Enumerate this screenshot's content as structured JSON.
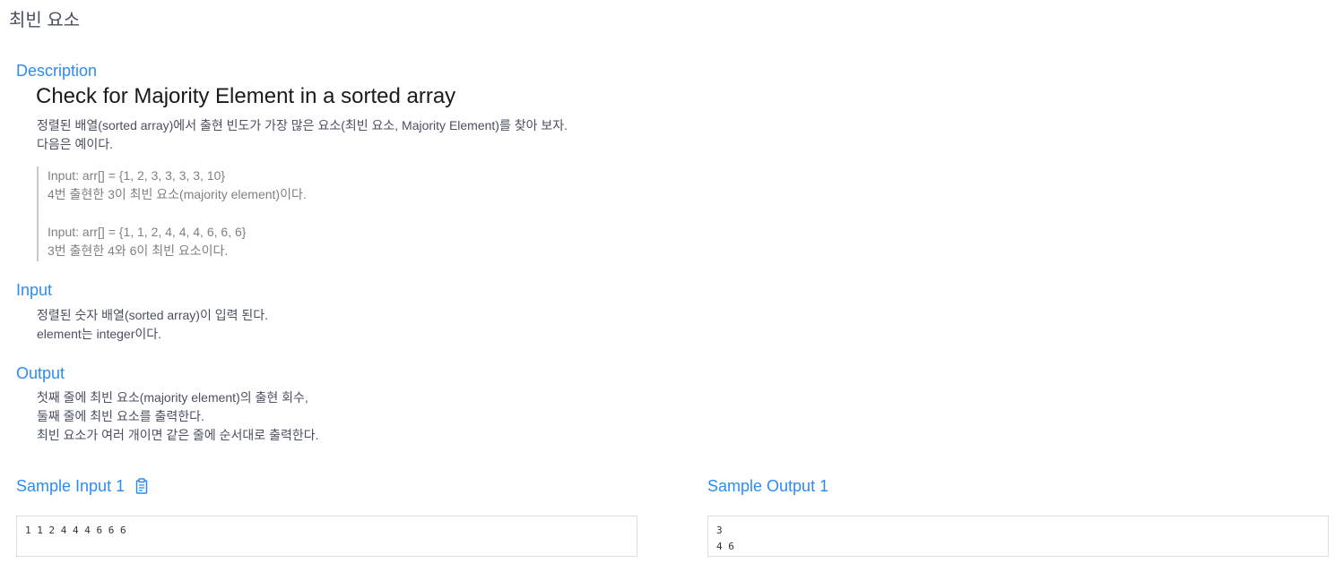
{
  "page_title": "최빈 요소",
  "description": {
    "heading": "Description",
    "problem_title": "Check for Majority Element in a sorted array",
    "lines": [
      "정렬된 배열(sorted array)에서 출현 빈도가 가장 많은 요소(최빈 요소, Majority Element)를 찾아 보자.",
      "다음은 예이다."
    ],
    "examples": [
      {
        "input": "Input: arr[] = {1, 2, 3, 3, 3, 3, 10}",
        "explain": "4번 출현한 3이 최빈 요소(majority element)이다."
      },
      {
        "input": "Input: arr[] = {1, 1, 2, 4, 4, 4, 6, 6, 6}",
        "explain": "3번 출현한 4와 6이 최빈 요소이다."
      }
    ]
  },
  "input": {
    "heading": "Input",
    "lines": [
      "정렬된 숫자 배열(sorted array)이 입력 된다.",
      "element는 integer이다."
    ]
  },
  "output": {
    "heading": "Output",
    "lines": [
      "첫째 줄에 최빈 요소(majority element)의 출현 회수,",
      "둘째 줄에 최빈 요소를 출력한다.",
      "최빈 요소가 여러 개이면 같은 줄에 순서대로 출력한다."
    ]
  },
  "sample_input": {
    "heading": "Sample Input 1",
    "content": "1 1 2 4 4 4 6 6 6"
  },
  "sample_output": {
    "heading": "Sample Output 1",
    "content": "3\n4 6"
  },
  "colors": {
    "accent": "#2d8cf0",
    "text": "#495060",
    "quote_text": "#808080",
    "quote_border": "#c8c8c8",
    "box_border": "#dcdee2"
  },
  "icons": {
    "copy": "clipboard-icon"
  }
}
